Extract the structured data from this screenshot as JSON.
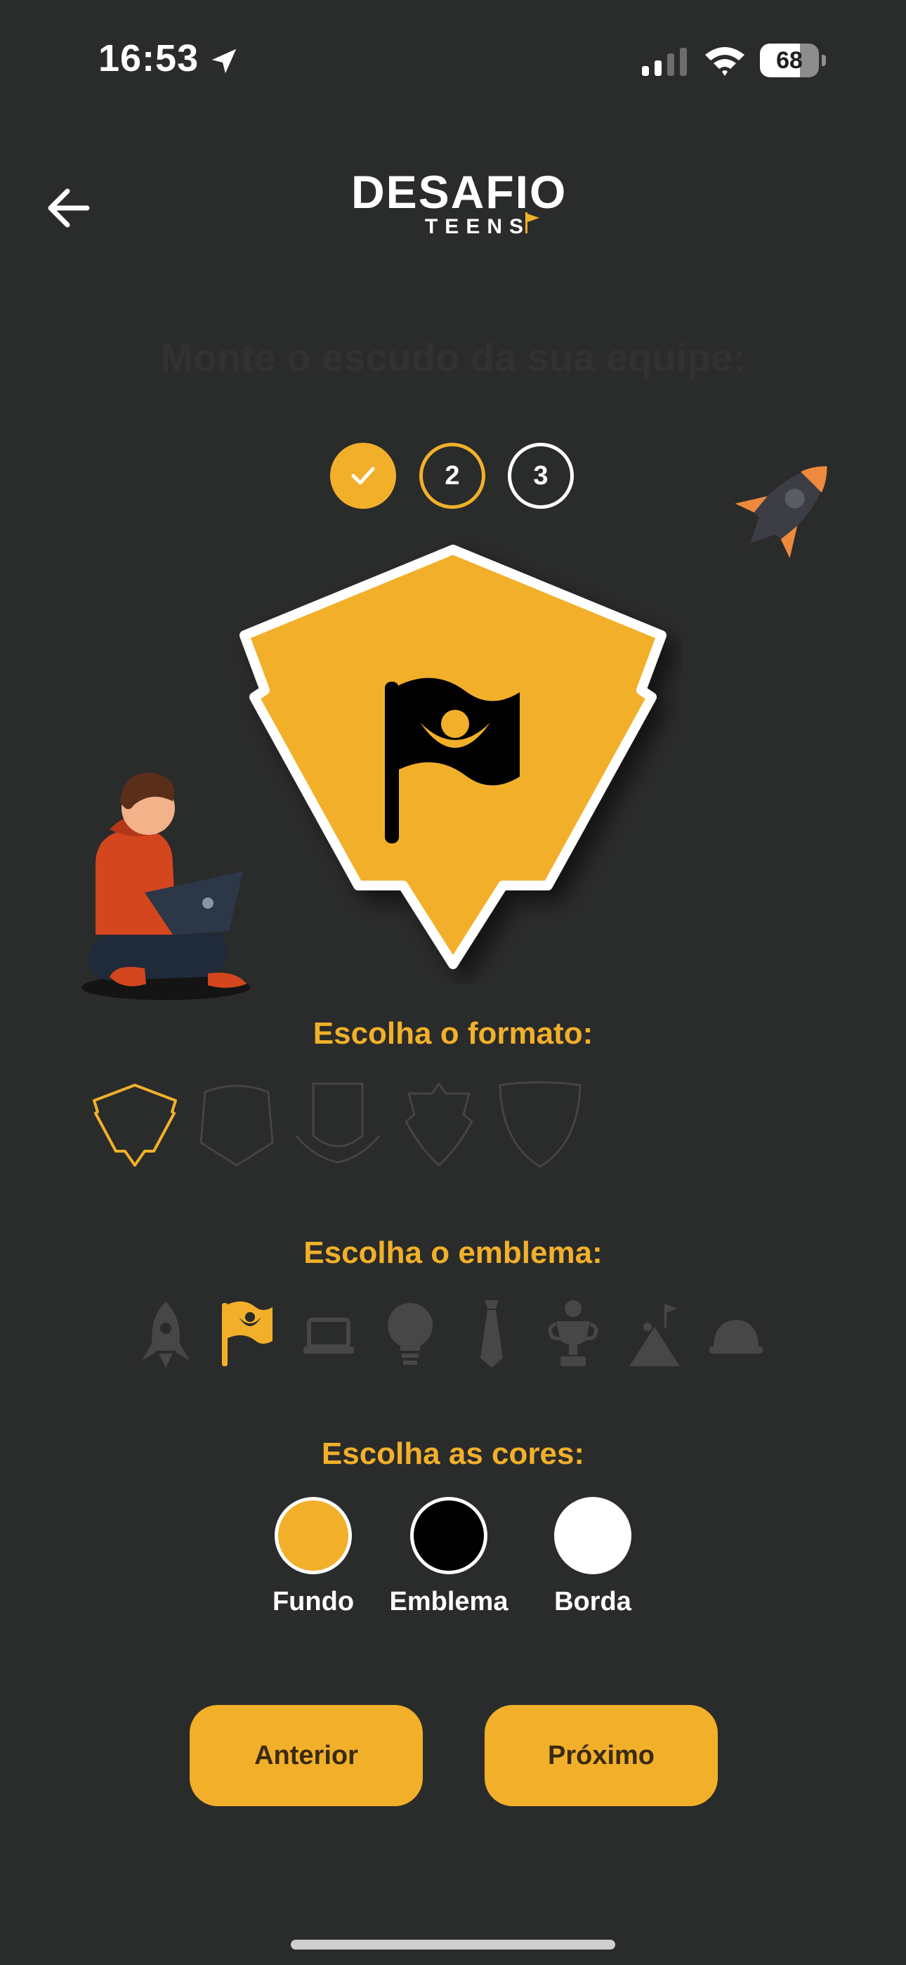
{
  "status_bar": {
    "time": "16:53",
    "battery": "68",
    "battery_level": 0.68
  },
  "header": {
    "logo_main": "DESAFIO",
    "logo_sub": "TEENS"
  },
  "page_title": "Monte o escudo da sua equipe:",
  "steps": [
    {
      "label": "✓",
      "state": "done"
    },
    {
      "label": "2",
      "state": "current"
    },
    {
      "label": "3",
      "state": "upcoming"
    }
  ],
  "sections": {
    "format": "Escolha o formato:",
    "emblem": "Escolha o emblema:",
    "colors": "Escolha as cores:"
  },
  "shape_options": [
    "lightning-shield-icon",
    "rounded-shield-icon",
    "banner-shield-icon",
    "crest-shield-icon",
    "classic-shield-icon"
  ],
  "selected_shape": "lightning-shield-icon",
  "emblem_options": [
    "rocket-icon",
    "flag-icon",
    "laptop-icon",
    "lightbulb-icon",
    "tie-icon",
    "trophy-icon",
    "climber-icon",
    "helmet-icon"
  ],
  "selected_emblem": "flag-icon",
  "colors": [
    {
      "label": "Fundo",
      "value": "#F2B02A"
    },
    {
      "label": "Emblema",
      "value": "#000000"
    },
    {
      "label": "Borda",
      "value": "#FFFFFF"
    }
  ],
  "buttons": {
    "previous": "Anterior",
    "next": "Próximo"
  },
  "theme": {
    "accent": "#F2B02A",
    "background": "#2A2B2B"
  }
}
